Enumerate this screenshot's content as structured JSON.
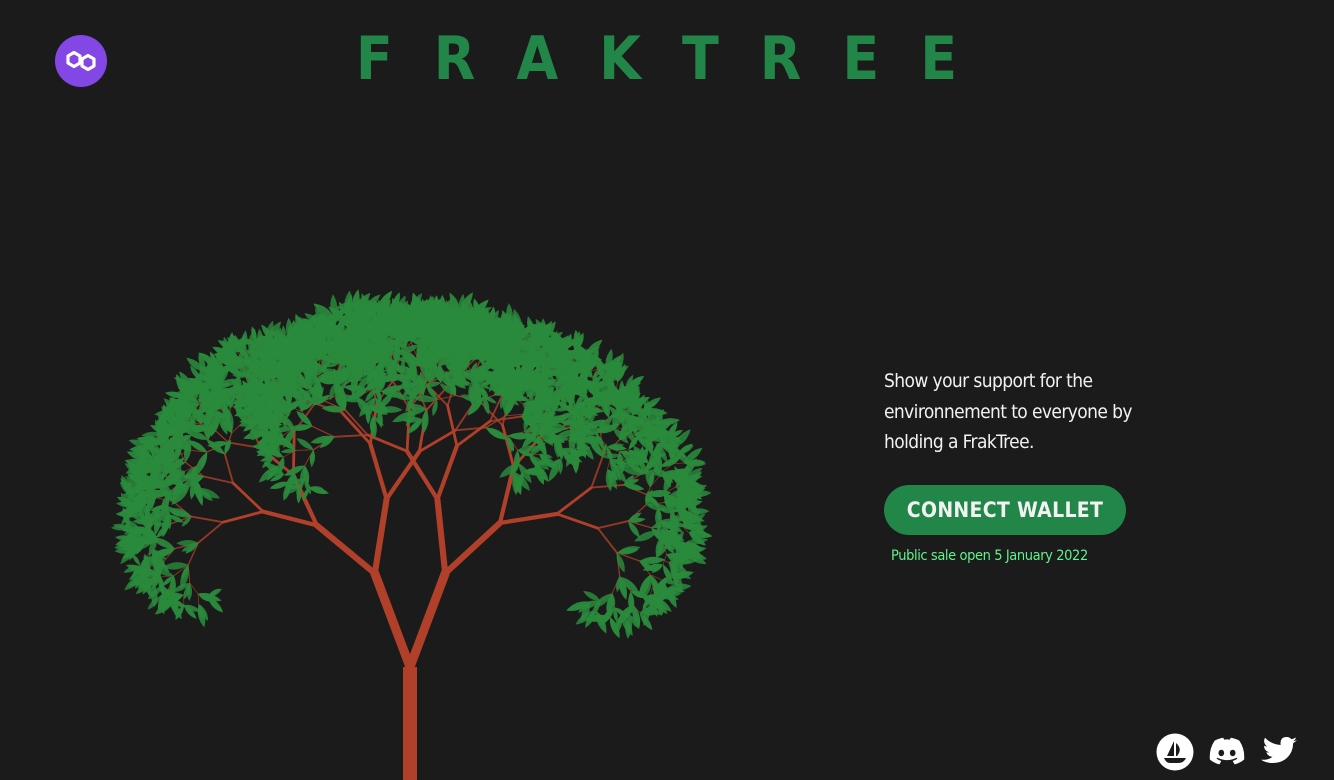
{
  "header": {
    "title": "FRAKTREE",
    "logo_icon": "polygon-logo-icon"
  },
  "colors": {
    "background": "#1b1b1b",
    "brand_green": "#218647",
    "leaf_green": "#2a8a3c",
    "branch_red": "#b0402a",
    "sale_text": "#5ef28c",
    "polygon_purple": "#8247e5"
  },
  "main": {
    "tagline": "Show your support for the environnement to everyone by holding a FrakTree.",
    "connect_label": "CONNECT WALLET",
    "sale_note": "Public sale open 5 January 2022"
  },
  "footer": {
    "icons": [
      "opensea-icon",
      "discord-icon",
      "twitter-icon"
    ]
  }
}
